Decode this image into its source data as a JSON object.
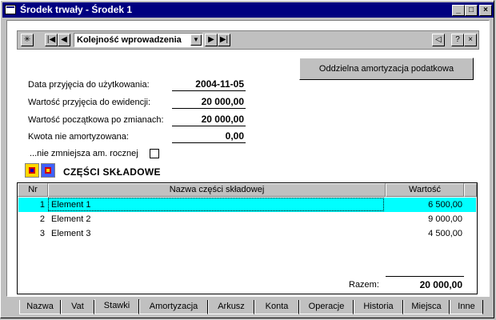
{
  "window": {
    "title": "Środek trwały - Środek 1"
  },
  "toolbar": {
    "sort_value": "Kolejność wprowadzenia"
  },
  "buttons": {
    "separate_depreciation": "Oddzielna amortyzacja podatkowa"
  },
  "fields": [
    {
      "label": "Data przyjęcia do użytkowania:",
      "value": "2004-11-05"
    },
    {
      "label": "Wartość przyjęcia do ewidencji:",
      "value": "20 000,00"
    },
    {
      "label": "Wartość początkowa po zmianach:",
      "value": "20 000,00"
    },
    {
      "label": "Kwota nie amortyzowana:",
      "value": "0,00"
    }
  ],
  "checkbox": {
    "label": "...nie zmniejsza am. rocznej",
    "checked": false
  },
  "section": {
    "title": "CZĘŚCI SKŁADOWE"
  },
  "table": {
    "headers": [
      "Nr",
      "Nazwa części składowej",
      "Wartość"
    ],
    "rows": [
      {
        "nr": "1",
        "name": "Element 1",
        "value": "6 500,00",
        "selected": true
      },
      {
        "nr": "2",
        "name": "Element 2",
        "value": "9 000,00",
        "selected": false
      },
      {
        "nr": "3",
        "name": "Element 3",
        "value": "4 500,00",
        "selected": false
      }
    ],
    "total_label": "Razem:",
    "total_value": "20 000,00"
  },
  "tabs": [
    "Nazwa",
    "Vat",
    "Stawki",
    "Amortyzacja",
    "Arkusz",
    "Konta",
    "Operacje",
    "Historia",
    "Miejsca",
    "Inne"
  ],
  "active_tab": "Stawki",
  "colors": {
    "titlebar": "#000080",
    "selection": "#00ffff",
    "face": "#c0c0c0"
  }
}
